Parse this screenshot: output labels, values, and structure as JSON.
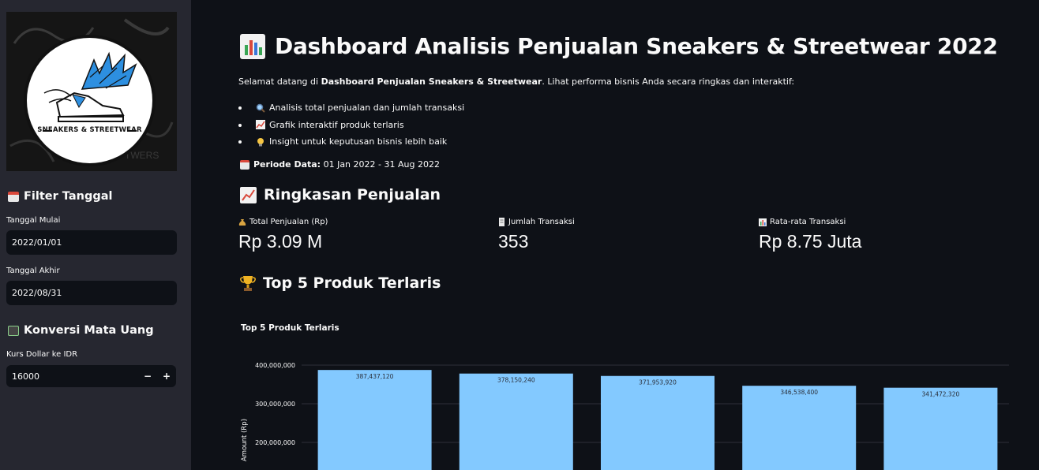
{
  "sidebar": {
    "logo_text": "SNEAKERS & STREETWEAR",
    "filter_heading": "Filter Tanggal",
    "start_label": "Tanggal Mulai",
    "start_value": "2022/01/01",
    "end_label": "Tanggal Akhir",
    "end_value": "2022/08/31",
    "currency_heading": "Konversi Mata Uang",
    "rate_label": "Kurs Dollar ke IDR",
    "rate_value": "16000",
    "minus": "−",
    "plus": "+"
  },
  "main": {
    "title": "Dashboard Analisis Penjualan Sneakers & Streetwear 2022",
    "intro_prefix": "Selamat datang di ",
    "intro_bold": "Dashboard Penjualan Sneakers & Streetwear",
    "intro_suffix": ". Lihat performa bisnis Anda secara ringkas dan interaktif:",
    "bullets": [
      {
        "icon": "magnifier-icon",
        "text": "Analisis total penjualan dan jumlah transaksi"
      },
      {
        "icon": "trend-chart-icon",
        "text": "Grafik interaktif produk terlaris"
      },
      {
        "icon": "lightbulb-icon",
        "text": "Insight untuk keputusan bisnis lebih baik"
      }
    ],
    "periode_label": "Periode Data:",
    "periode_value": " 01 Jan 2022 - 31 Aug 2022",
    "summary_heading": "Ringkasan Penjualan",
    "metrics": [
      {
        "icon": "money-bag-icon",
        "label": "Total Penjualan (Rp)",
        "value": "Rp 3.09 M"
      },
      {
        "icon": "receipt-icon",
        "label": "Jumlah Transaksi",
        "value": "353"
      },
      {
        "icon": "bar-chart-icon",
        "label": "Rata-rata Transaksi",
        "value": "Rp 8.75 Juta"
      }
    ],
    "top_heading": "Top 5 Produk Terlaris"
  },
  "colors": {
    "bar": "#83c9ff",
    "background": "#0e1117",
    "sidebar": "#262730"
  },
  "chart_data": {
    "type": "bar",
    "title": "Top 5 Produk Terlaris",
    "ylabel": "Amount (Rp)",
    "xlabel": "",
    "values": [
      387437120,
      378150240,
      371953920,
      346538400,
      341472320
    ],
    "value_labels": [
      "387,437,120",
      "378,150,240",
      "371,953,920",
      "346,538,400",
      "341,472,320"
    ],
    "yticks": [
      200000000,
      300000000,
      400000000
    ],
    "ytick_labels": [
      "200,000,000",
      "300,000,000",
      "400,000,000"
    ],
    "ylim": [
      0,
      420000000
    ],
    "grid": true,
    "legend": "none"
  }
}
